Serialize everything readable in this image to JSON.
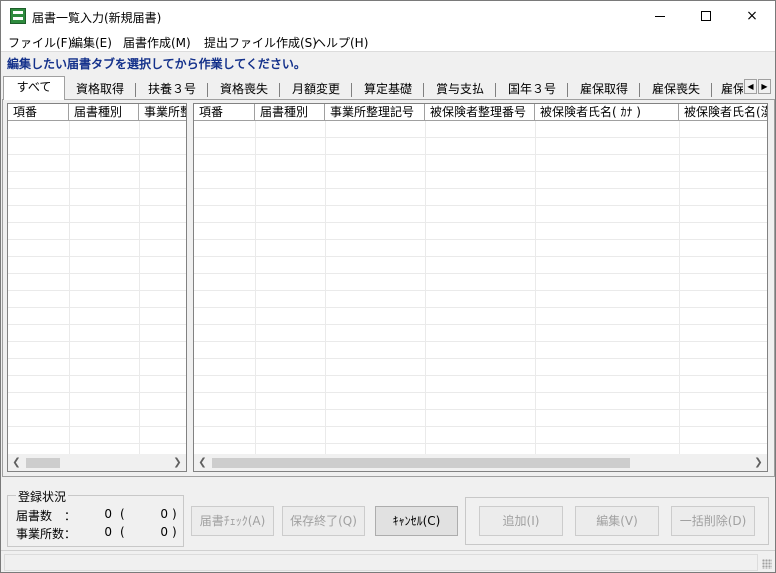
{
  "window": {
    "title": "届書一覧入力(新規届書)",
    "controls": {
      "minimize": "minimize",
      "maximize": "maximize",
      "close": "×"
    }
  },
  "menu": [
    {
      "label": "ファイル(F)"
    },
    {
      "label": "編集(E)"
    },
    {
      "label": "届書作成(M)"
    },
    {
      "label": "提出ファイル作成(S)"
    },
    {
      "label": "ヘルプ(H)"
    }
  ],
  "instruction": "編集したい届書タブを選択してから作業してください。",
  "tabs": [
    {
      "label": "すべて",
      "active": true
    },
    {
      "label": "資格取得"
    },
    {
      "label": "扶養３号"
    },
    {
      "label": "資格喪失"
    },
    {
      "label": "月額変更"
    },
    {
      "label": "算定基礎"
    },
    {
      "label": "賞与支払"
    },
    {
      "label": "国年３号"
    },
    {
      "label": "雇保取得"
    },
    {
      "label": "雇保喪失"
    },
    {
      "label": "雇保"
    }
  ],
  "left_grid": {
    "columns": [
      "項番",
      "届書種別",
      "事業所整"
    ]
  },
  "right_grid": {
    "columns": [
      "項番",
      "届書種別",
      "事業所整理記号",
      "被保険者整理番号",
      "被保険者氏名( ｶﾅ )",
      "被保険者氏名(漢"
    ]
  },
  "status": {
    "group_title": "登録状況",
    "rows": [
      {
        "label": "届書数",
        "colon": "：",
        "count": "0",
        "paren_open": "(",
        "sub": "0",
        "paren_close": ")"
      },
      {
        "label": "事業所数",
        "colon": "：",
        "count": "0",
        "paren_open": "(",
        "sub": "0",
        "paren_close": ")"
      }
    ]
  },
  "buttons": {
    "check": "届書ﾁｪｯｸ(A)",
    "save_exit": "保存終了(Q)",
    "cancel": "ｷｬﾝｾﾙ(C)",
    "add": "追加(I)",
    "edit": "編集(V)",
    "bulk_delete": "一括削除(D)"
  },
  "colors": {
    "instruction_text": "#14318b",
    "disabled_text": "#a0a0a0"
  }
}
